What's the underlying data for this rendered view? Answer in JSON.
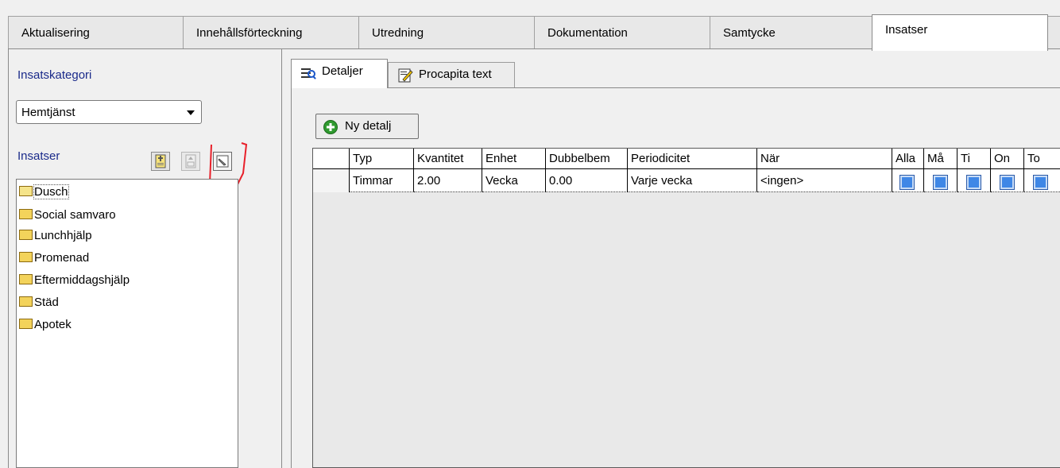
{
  "main_tabs": [
    "Aktualisering",
    "Innehållsförteckning",
    "Utredning",
    "Dokumentation",
    "Samtycke",
    "Insatser"
  ],
  "active_main_tab": "Insatser",
  "left": {
    "category_label": "Insatskategori",
    "category_value": "Hemtjänst",
    "insatser_label": "Insatser",
    "tree_items": [
      "Dusch",
      "Social samvaro",
      "Lunchhjälp",
      "Promenad",
      "Eftermiddagshjälp",
      "Städ",
      "Apotek"
    ]
  },
  "sub_tabs": [
    "Detaljer",
    "Procapita text"
  ],
  "new_button_label": "Ny detalj",
  "grid": {
    "headers": [
      "Typ",
      "Kvantitet",
      "Enhet",
      "Dubbelbem",
      "Periodicitet",
      "När",
      "Alla",
      "Må",
      "Ti",
      "On",
      "To"
    ],
    "row": [
      "Timmar",
      "2.00",
      "Vecka",
      "0.00",
      "Varje vecka",
      "<ingen>"
    ],
    "day_checks": [
      false,
      false,
      false,
      false,
      false
    ]
  },
  "colors": {
    "label_blue": "#1a2a8a",
    "checkbox_blue": "#3f87e6",
    "annotation_red": "#e8202a"
  }
}
